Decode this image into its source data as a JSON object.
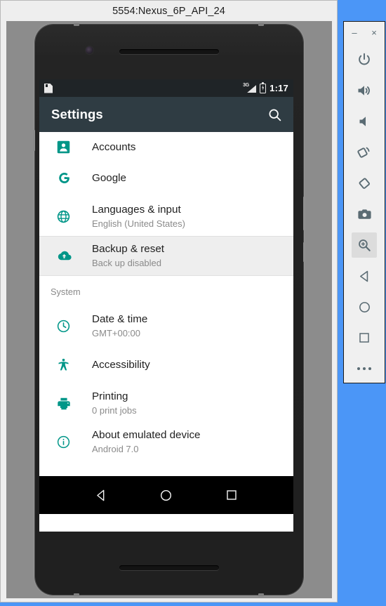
{
  "desktop": {
    "background_color": "#4b96f7"
  },
  "emulator_window": {
    "title": "5554:Nexus_6P_API_24"
  },
  "phone": {
    "status_bar": {
      "sd_card_icon": "sd-card-icon",
      "network_label": "3G",
      "signal_icon": "signal-bars-icon",
      "battery_icon": "battery-charging-icon",
      "time": "1:17"
    },
    "app_bar": {
      "title": "Settings",
      "search_icon": "search-icon"
    },
    "settings_items": [
      {
        "id": "accounts",
        "icon": "account-box-icon",
        "title": "Accounts",
        "subtitle": "",
        "highlighted": false,
        "clipped": true
      },
      {
        "id": "google",
        "icon": "google-g-icon",
        "title": "Google",
        "subtitle": "",
        "highlighted": false,
        "clipped": false
      },
      {
        "id": "languages-input",
        "icon": "globe-icon",
        "title": "Languages & input",
        "subtitle": "English (United States)",
        "highlighted": false,
        "clipped": false
      },
      {
        "id": "backup-reset",
        "icon": "cloud-upload-icon",
        "title": "Backup & reset",
        "subtitle": "Back up disabled",
        "highlighted": true,
        "clipped": false
      }
    ],
    "section_header": "System",
    "system_items": [
      {
        "id": "date-time",
        "icon": "clock-icon",
        "title": "Date & time",
        "subtitle": "GMT+00:00"
      },
      {
        "id": "accessibility",
        "icon": "accessibility-icon",
        "title": "Accessibility",
        "subtitle": ""
      },
      {
        "id": "printing",
        "icon": "printer-icon",
        "title": "Printing",
        "subtitle": "0 print jobs"
      },
      {
        "id": "about-device",
        "icon": "info-circle-icon",
        "title": "About emulated device",
        "subtitle": "Android 7.0"
      }
    ],
    "nav_bar": {
      "back": "back-triangle-icon",
      "home": "home-circle-icon",
      "recents": "recents-square-icon"
    },
    "accent_color": "#009688"
  },
  "emulator_toolbar": {
    "minimize_label": "–",
    "close_label": "×",
    "buttons": [
      {
        "id": "power",
        "icon": "power-icon",
        "active": false
      },
      {
        "id": "volume-up",
        "icon": "volume-up-icon",
        "active": false
      },
      {
        "id": "volume-down",
        "icon": "volume-down-icon",
        "active": false
      },
      {
        "id": "rotate-left",
        "icon": "rotate-left-icon",
        "active": false
      },
      {
        "id": "rotate-right",
        "icon": "rotate-right-icon",
        "active": false
      },
      {
        "id": "screenshot",
        "icon": "camera-icon",
        "active": false
      },
      {
        "id": "zoom",
        "icon": "zoom-in-icon",
        "active": true
      },
      {
        "id": "back",
        "icon": "back-triangle-icon",
        "active": false
      },
      {
        "id": "home",
        "icon": "home-circle-icon",
        "active": false
      },
      {
        "id": "overview",
        "icon": "recents-square-icon",
        "active": false
      },
      {
        "id": "more",
        "icon": "more-dots-icon",
        "active": false
      }
    ]
  }
}
